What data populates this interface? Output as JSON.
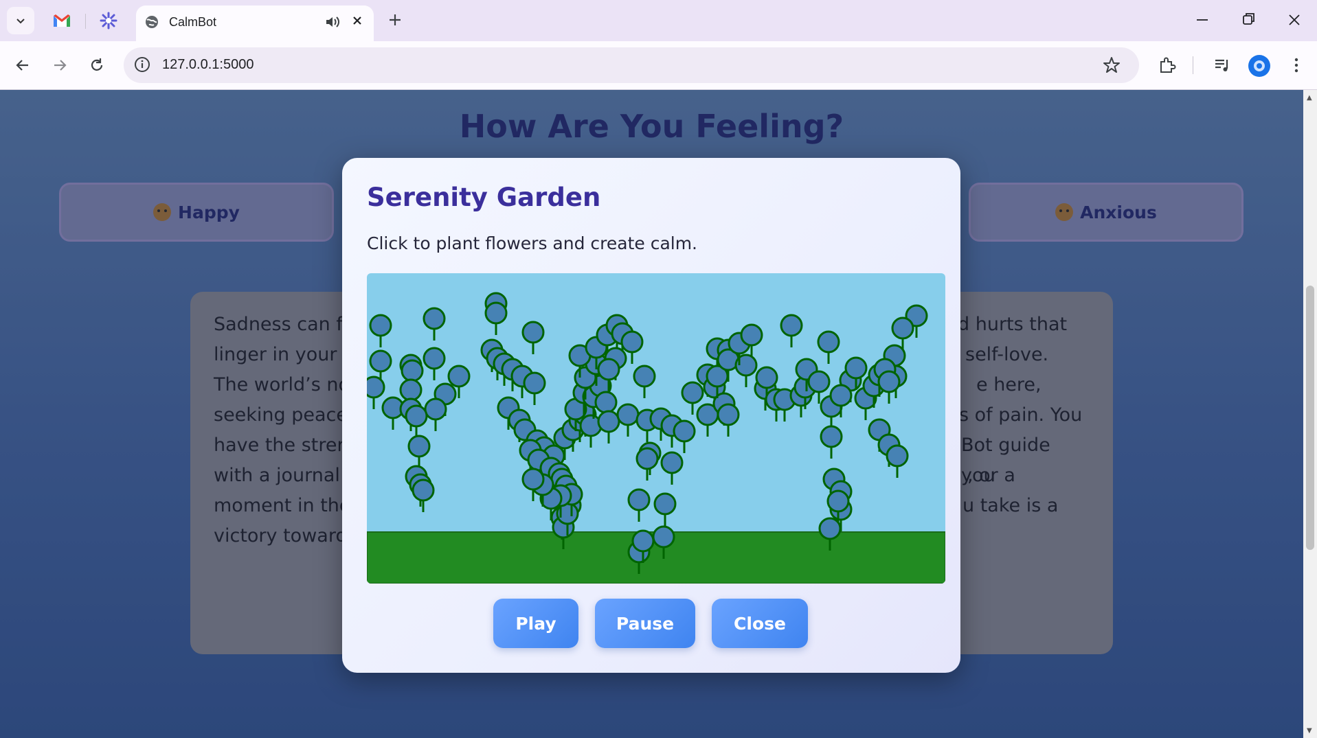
{
  "browser": {
    "tab_title": "CalmBot",
    "url": "127.0.0.1:5000"
  },
  "page": {
    "title": "How Are You Feeling?",
    "moods": [
      {
        "label": "Happy",
        "emoji": "smiling-face-icon"
      },
      {
        "label": "Anxious",
        "emoji": "worried-face-icon"
      }
    ],
    "content_lines": [
      "Sadness can f",
      "linger in your h",
      "The world’s no",
      "seeking peace",
      "have the stren",
      "with a journal",
      "moment in the",
      "victory toward"
    ],
    "content_lines_right": [
      "d hurts that",
      "self-love.",
      "e here,",
      "s of pain. You",
      "Bot guide you",
      ", or a",
      "u take is a",
      ""
    ]
  },
  "modal": {
    "title": "Serenity Garden",
    "subtitle": "Click to plant flowers and create calm.",
    "buttons": {
      "play": "Play",
      "pause": "Pause",
      "close": "Close"
    },
    "colors": {
      "sky": "#87ceeb",
      "ground": "#228b22",
      "flower": "#4682b4",
      "stem": "#006400"
    }
  }
}
